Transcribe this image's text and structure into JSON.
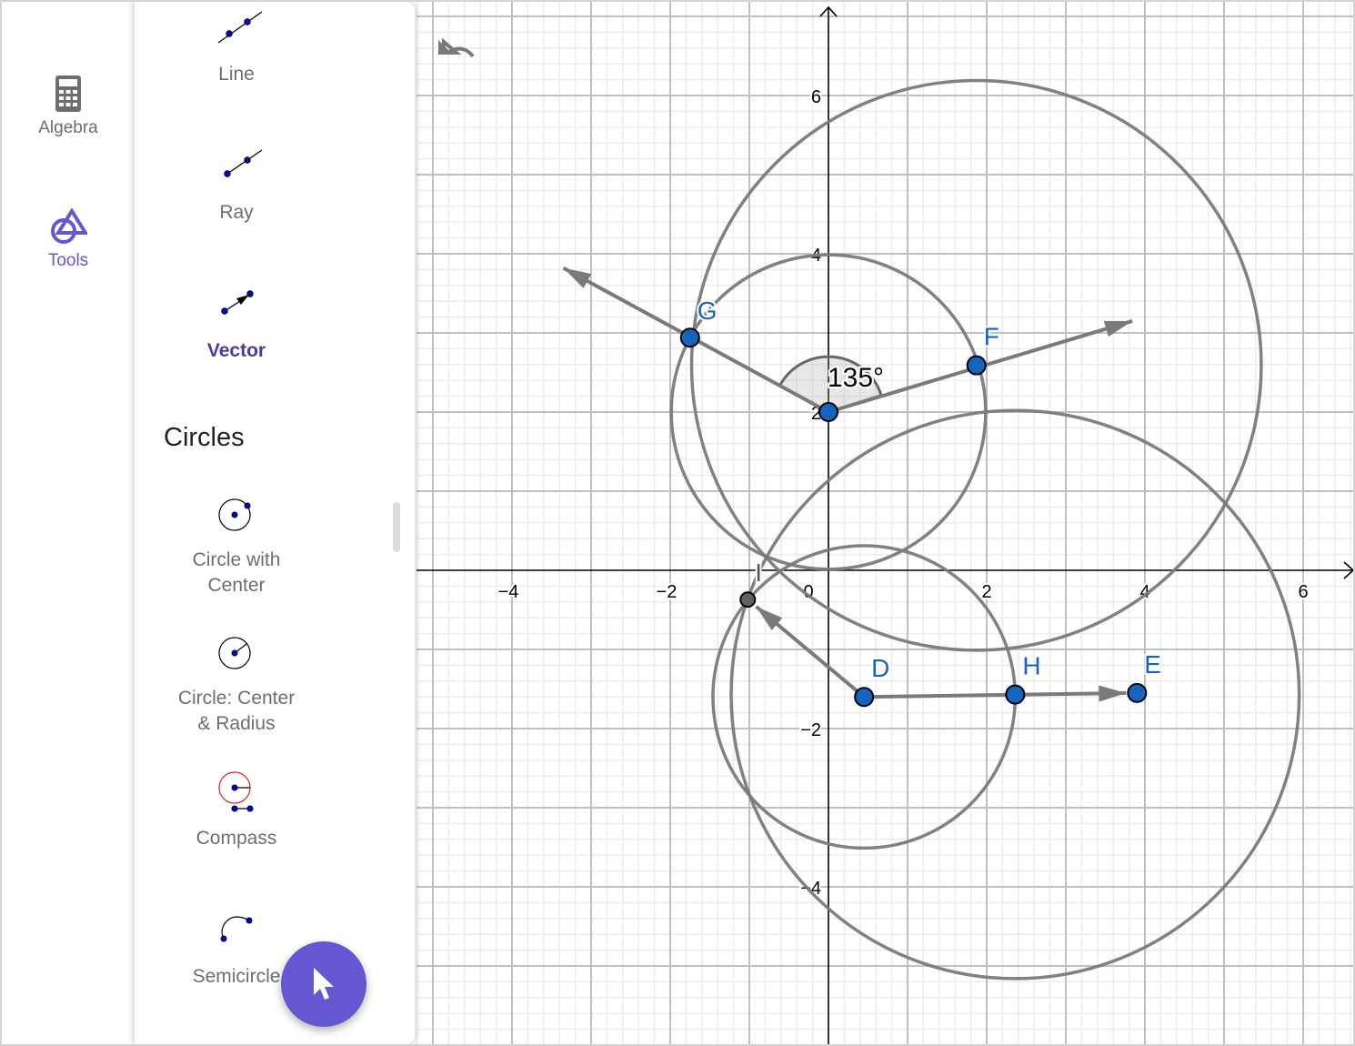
{
  "rail": {
    "items": [
      {
        "label": "Algebra",
        "icon": "calculator-icon",
        "active": false
      },
      {
        "label": "Tools",
        "icon": "shapes-icon",
        "active": true
      }
    ]
  },
  "tools_panel": {
    "items_top": [
      {
        "label": "Line",
        "icon": "line-tool-icon"
      },
      {
        "label": "Ray",
        "icon": "ray-tool-icon"
      },
      {
        "label": "Vector",
        "icon": "vector-tool-icon",
        "selected": true
      }
    ],
    "section_title": "Circles",
    "items_circles": [
      {
        "label_lines": [
          "Circle with",
          "Center"
        ],
        "icon": "circle-with-center-icon"
      },
      {
        "label_lines": [
          "Circle: Center",
          "& Radius"
        ],
        "icon": "circle-center-radius-icon"
      },
      {
        "label_lines": [
          "Compass"
        ],
        "icon": "compass-icon"
      },
      {
        "label_lines": [
          "Semicircle"
        ],
        "icon": "semicircle-icon"
      }
    ]
  },
  "fab": {
    "icon": "move-pointer-icon"
  },
  "undo": {
    "icon": "undo-icon"
  },
  "colors": {
    "accent": "#6557d2",
    "selected_tool": "#4a3aa8",
    "point_fill": "#1565c0",
    "point_label": "#1565c0",
    "object_stroke": "#7a7a7a",
    "intersection_point": "#616161"
  },
  "graph": {
    "x_ticks": [
      -4,
      -2,
      0,
      2,
      4,
      6
    ],
    "y_ticks": [
      -4,
      -2,
      2,
      4,
      6
    ],
    "x_range": [
      -5.2,
      6.6
    ],
    "y_range": [
      -6.0,
      7.2
    ],
    "points": [
      {
        "name": "C",
        "label": "",
        "x": 0,
        "y": 2,
        "kind": "free"
      },
      {
        "name": "G",
        "label": "G",
        "x": -1.75,
        "y": 2.94,
        "kind": "free"
      },
      {
        "name": "F",
        "label": "F",
        "x": 1.87,
        "y": 2.59,
        "kind": "free"
      },
      {
        "name": "D",
        "label": "D",
        "x": 0.45,
        "y": -1.6,
        "kind": "free"
      },
      {
        "name": "H",
        "label": "H",
        "x": 2.36,
        "y": -1.57,
        "kind": "free"
      },
      {
        "name": "E",
        "label": "E",
        "x": 3.9,
        "y": -1.55,
        "kind": "free"
      },
      {
        "name": "I",
        "label": "I",
        "x": -1.02,
        "y": -0.37,
        "kind": "intersection"
      }
    ],
    "rays": [
      {
        "from": "C",
        "through": "G",
        "to_x": -3.35,
        "to_y": 3.82
      },
      {
        "from": "C",
        "through": "F",
        "to_x": 3.84,
        "to_y": 3.15
      }
    ],
    "vectors": [
      {
        "from": "D",
        "to": "E"
      },
      {
        "from": "D",
        "to": "I"
      }
    ],
    "circles": [
      {
        "center": "C",
        "through": "G"
      },
      {
        "center": "F",
        "radius": 3.6
      },
      {
        "center": "D",
        "through": "H"
      },
      {
        "center": "H",
        "radius": 3.59
      }
    ],
    "angle": {
      "vertex": "C",
      "from": "F",
      "to": "G",
      "label": "135°"
    }
  }
}
